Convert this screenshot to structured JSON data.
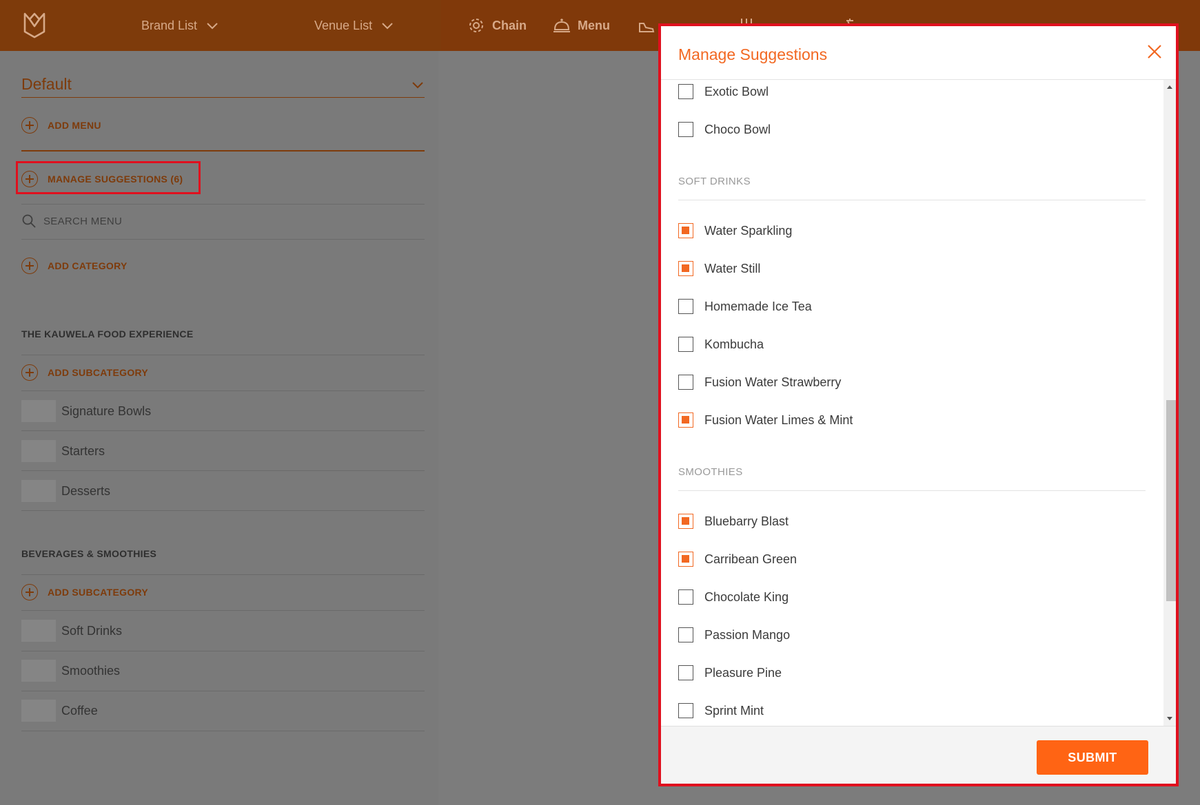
{
  "topbar": {
    "brand_list": "Brand List",
    "venue_list": "Venue List",
    "nav": [
      {
        "label": "Chain",
        "icon": "gear-icon"
      },
      {
        "label": "Menu",
        "icon": "cloche-icon"
      },
      {
        "label": "",
        "icon": "shoe-icon"
      },
      {
        "label": "",
        "icon": "sliders-icon"
      },
      {
        "label": "",
        "icon": "translate-icon"
      }
    ]
  },
  "left_panel": {
    "menu_select": "Default",
    "add_menu": "ADD MENU",
    "manage_suggestions": "MANAGE SUGGESTIONS (6)",
    "search_placeholder": "SEARCH MENU",
    "add_category": "ADD CATEGORY",
    "categories": [
      {
        "title": "THE KAUWELA FOOD EXPERIENCE",
        "add_subcategory": "ADD SUBCATEGORY",
        "subcategories": [
          "Signature Bowls",
          "Starters",
          "Desserts"
        ]
      },
      {
        "title": "BEVERAGES & SMOOTHIES",
        "add_subcategory": "ADD SUBCATEGORY",
        "subcategories": [
          "Soft Drinks",
          "Smoothies",
          "Coffee"
        ]
      }
    ]
  },
  "modal": {
    "title": "Manage Suggestions",
    "top_items": [
      {
        "label": "Exotic Bowl",
        "checked": false
      },
      {
        "label": "Choco Bowl",
        "checked": false
      }
    ],
    "sections": [
      {
        "label": "SOFT DRINKS",
        "items": [
          {
            "label": "Water Sparkling",
            "checked": true
          },
          {
            "label": "Water Still",
            "checked": true
          },
          {
            "label": "Homemade Ice Tea",
            "checked": false
          },
          {
            "label": "Kombucha",
            "checked": false
          },
          {
            "label": "Fusion Water Strawberry",
            "checked": false
          },
          {
            "label": "Fusion Water Limes & Mint",
            "checked": true
          }
        ]
      },
      {
        "label": "SMOOTHIES",
        "items": [
          {
            "label": "Bluebarry Blast",
            "checked": true
          },
          {
            "label": "Carribean Green",
            "checked": true
          },
          {
            "label": "Chocolate King",
            "checked": false
          },
          {
            "label": "Passion Mango",
            "checked": false
          },
          {
            "label": "Pleasure Pine",
            "checked": false
          },
          {
            "label": "Sprint Mint",
            "checked": false
          }
        ]
      }
    ],
    "submit_label": "SUBMIT"
  },
  "colors": {
    "accent": "#f26822",
    "submit": "#ff6414",
    "topbar": "#7e3b0b",
    "highlight": "#e0101e"
  }
}
